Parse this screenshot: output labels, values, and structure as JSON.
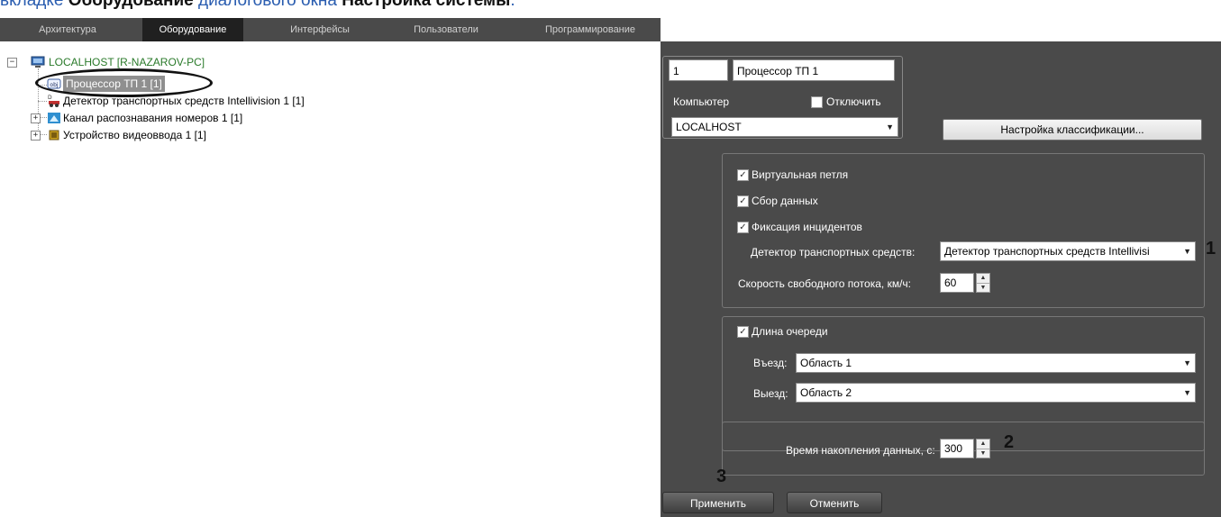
{
  "caption": {
    "prefix": "вкладке ",
    "bold1": "Оборудование",
    "middle": " диалогового окна ",
    "bold2": "Настройка системы",
    "suffix": "."
  },
  "tabs": [
    {
      "label": "Архитектура"
    },
    {
      "label": "Оборудование",
      "active": true
    },
    {
      "label": "Интерфейсы"
    },
    {
      "label": "Пользователи"
    },
    {
      "label": "Программирование"
    }
  ],
  "tree": {
    "root": {
      "label": "LOCALHOST [R-NAZAROV-PC]",
      "icon": "computer-icon"
    },
    "items": [
      {
        "label": "Процессор ТП 1 [1]",
        "icon": "obj-icon",
        "selected": true
      },
      {
        "label": "Детектор транспортных средств Intellivision 1 [1]",
        "icon": "vehicle-detector-icon"
      },
      {
        "label": "Канал распознавания номеров 1 [1]",
        "icon": "plate-recognition-icon"
      },
      {
        "label": "Устройство видеоввода 1 [1]",
        "icon": "chip-icon"
      }
    ]
  },
  "settings": {
    "id_value": "1",
    "name_value": "Процессор ТП 1",
    "computer_label": "Компьютер",
    "disable_label": "Отключить",
    "computer_value": "LOCALHOST",
    "classification_button": "Настройка классификации...",
    "virtual_loop_label": "Виртуальная петля",
    "data_collection_label": "Сбор данных",
    "incident_label": "Фиксация инцидентов",
    "detector_label": "Детектор транспортных средств:",
    "detector_value": "Детектор транспортных средств Intellivisi",
    "speed_label": "Скорость свободного потока, км/ч:",
    "speed_value": "60",
    "queue_label": "Длина очереди",
    "entry_label": "Въезд:",
    "entry_value": "Область 1",
    "exit_label": "Выезд:",
    "exit_value": "Область 2",
    "accum_label": "Время накопления данных, с:",
    "accum_value": "300"
  },
  "markers": {
    "m1": "1",
    "m2": "2",
    "m3": "3"
  },
  "buttons": {
    "apply": "Применить",
    "cancel": "Отменить"
  }
}
